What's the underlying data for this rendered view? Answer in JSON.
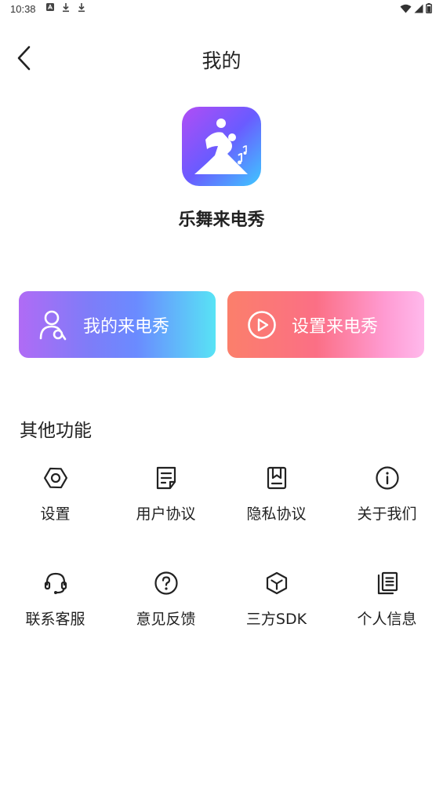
{
  "status_bar": {
    "time": "10:38"
  },
  "header": {
    "title": "我的"
  },
  "app": {
    "name": "乐舞来电秀"
  },
  "actions": {
    "my_ringtone": "我的来电秀",
    "set_ringtone": "设置来电秀"
  },
  "section": {
    "title": "其他功能"
  },
  "features": [
    {
      "label": "设置",
      "icon": "hexagon-settings-icon"
    },
    {
      "label": "用户协议",
      "icon": "document-edit-icon"
    },
    {
      "label": "隐私协议",
      "icon": "bookmark-book-icon"
    },
    {
      "label": "关于我们",
      "icon": "info-icon"
    },
    {
      "label": "联系客服",
      "icon": "headset-icon"
    },
    {
      "label": "意见反馈",
      "icon": "question-icon"
    },
    {
      "label": "三方SDK",
      "icon": "cube-icon"
    },
    {
      "label": "个人信息",
      "icon": "copy-document-icon"
    }
  ],
  "colors": {
    "text_primary": "#222222",
    "card_my_gradient": [
      "#b06bf5",
      "#58e3f5"
    ],
    "card_set_gradient": [
      "#fb7f6b",
      "#ffb9ec"
    ]
  }
}
